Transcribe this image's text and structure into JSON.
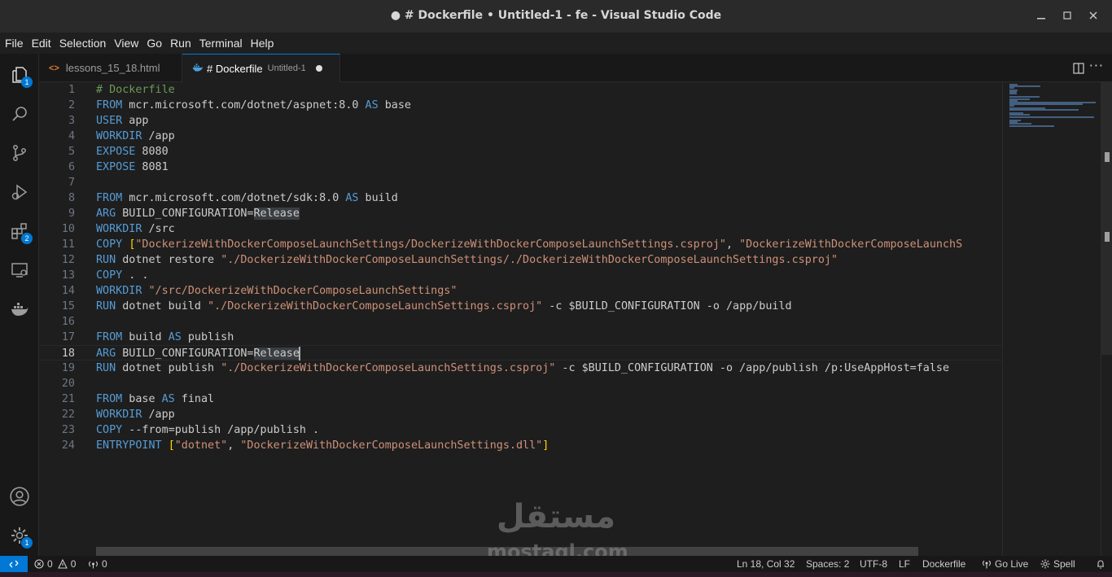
{
  "window": {
    "title": "● # Dockerfile • Untitled-1 - fe - Visual Studio Code"
  },
  "menu": [
    "File",
    "Edit",
    "Selection",
    "View",
    "Go",
    "Run",
    "Terminal",
    "Help"
  ],
  "activity": {
    "explorer_badge": "1",
    "extensions_badge": "2",
    "manage_badge": "1"
  },
  "tabs": [
    {
      "icon_text": "<>",
      "label": "lessons_15_18.html"
    },
    {
      "label": "# Dockerfile",
      "description": "Untitled-1"
    }
  ],
  "editor": {
    "language": "Dockerfile",
    "current_line": 18,
    "lines": [
      "# Dockerfile",
      "FROM mcr.microsoft.com/dotnet/aspnet:8.0 AS base",
      "USER app",
      "WORKDIR /app",
      "EXPOSE 8080",
      "EXPOSE 8081",
      "",
      "FROM mcr.microsoft.com/dotnet/sdk:8.0 AS build",
      "ARG BUILD_CONFIGURATION=Release",
      "WORKDIR /src",
      "COPY [\"DockerizeWithDockerComposeLaunchSettings/DockerizeWithDockerComposeLaunchSettings.csproj\", \"DockerizeWithDockerComposeLaunchS",
      "RUN dotnet restore \"./DockerizeWithDockerComposeLaunchSettings/./DockerizeWithDockerComposeLaunchSettings.csproj\"",
      "COPY . .",
      "WORKDIR \"/src/DockerizeWithDockerComposeLaunchSettings\"",
      "RUN dotnet build \"./DockerizeWithDockerComposeLaunchSettings.csproj\" -c $BUILD_CONFIGURATION -o /app/build",
      "",
      "FROM build AS publish",
      "ARG BUILD_CONFIGURATION=Release",
      "RUN dotnet publish \"./DockerizeWithDockerComposeLaunchSettings.csproj\" -c $BUILD_CONFIGURATION -o /app/publish /p:UseAppHost=false",
      "",
      "FROM base AS final",
      "WORKDIR /app",
      "COPY --from=publish /app/publish .",
      "ENTRYPOINT [\"dotnet\", \"DockerizeWithDockerComposeLaunchSettings.dll\"]"
    ]
  },
  "statusbar": {
    "errors": "0",
    "warnings": "0",
    "ports": "0",
    "position": "Ln 18, Col 32",
    "spaces": "Spaces: 2",
    "encoding": "UTF-8",
    "eol": "LF",
    "language": "Dockerfile",
    "golive": "Go Live",
    "spell": "Spell"
  },
  "watermark": {
    "arabic": "مستقل",
    "latin": "mostaql.com"
  },
  "colors": {
    "accent": "#0078d4",
    "keyword": "#569cd6",
    "string": "#ce9178",
    "comment": "#6a9955"
  }
}
